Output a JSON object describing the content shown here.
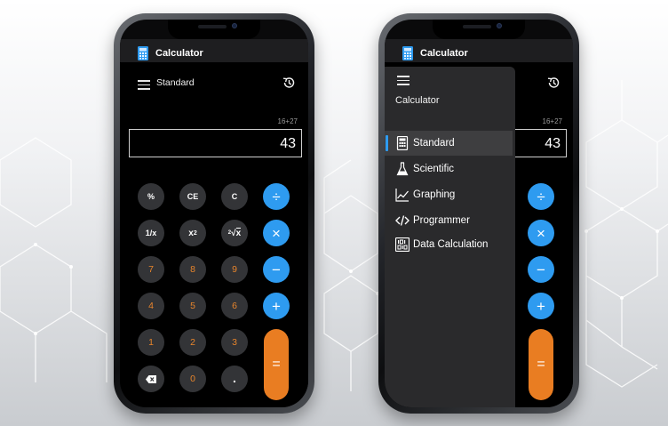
{
  "left_phone": {
    "app_title": "Calculator",
    "mode_title": "Standard",
    "expression": "16+27",
    "display_value": "43",
    "keys": {
      "r1": [
        "%",
        "CE",
        "C"
      ],
      "r2": [
        "1/x",
        "x²",
        "²√x"
      ],
      "r3": [
        "7",
        "8",
        "9"
      ],
      "r4": [
        "4",
        "5",
        "6"
      ],
      "r5": [
        "1",
        "2",
        "3"
      ],
      "r6_zero": "0",
      "r6_decimal": "."
    },
    "operators": [
      "÷",
      "×",
      "−",
      "+"
    ],
    "equals": "=",
    "icons": [
      "calculator-app-icon",
      "hamburger-icon",
      "history-icon",
      "backspace-icon"
    ]
  },
  "right_phone": {
    "app_title": "Calculator",
    "drawer_title": "Calculator",
    "display_value": "43",
    "expression": "16+27",
    "menu": [
      {
        "label": "Standard",
        "icon": "calculator-icon",
        "selected": true
      },
      {
        "label": "Scientific",
        "icon": "flask-icon",
        "selected": false
      },
      {
        "label": "Graphing",
        "icon": "graph-icon",
        "selected": false
      },
      {
        "label": "Programmer",
        "icon": "code-icon",
        "selected": false
      },
      {
        "label": "Data Calculation",
        "icon": "binary-icon",
        "selected": false
      }
    ],
    "operators": [
      "÷",
      "×",
      "−",
      "+"
    ],
    "equals": "="
  },
  "colors": {
    "accent_blue": "#2e9bf0",
    "accent_orange": "#e97d22",
    "digit_orange": "#e8852c",
    "key_gray": "#333437",
    "drawer_bg": "#2a2a2c"
  }
}
